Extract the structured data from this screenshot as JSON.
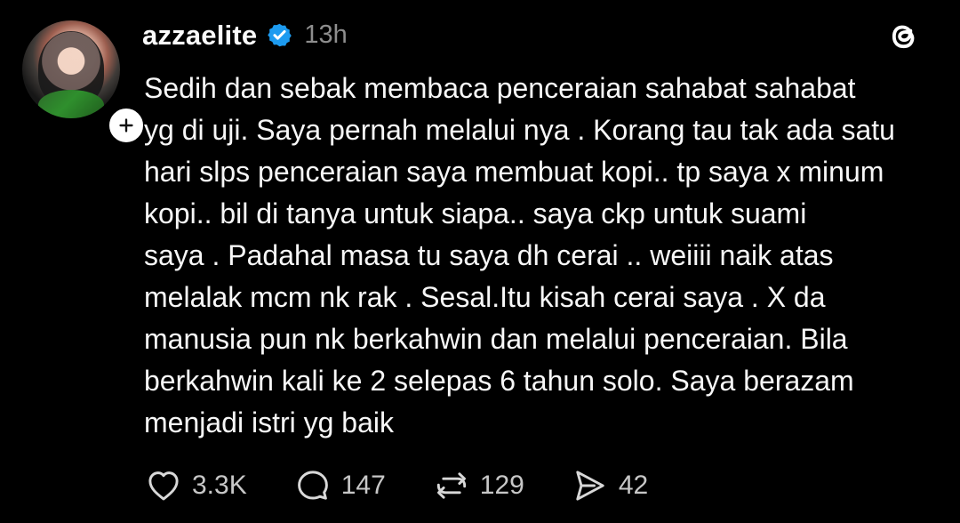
{
  "post": {
    "author": {
      "username": "azzaelite",
      "verified": true,
      "avatar_icon": "profile-avatar",
      "follow_icon": "plus-icon"
    },
    "time": "13h",
    "app_icon": "threads-logo",
    "text_lines": [
      "Sedih dan sebak membaca penceraian sahabat sahabat",
      "yg di uji. Saya pernah melalui nya . Korang tau tak ada satu",
      "hari slps penceraian saya membuat kopi.. tp saya x minum",
      "kopi.. bil di tanya untuk siapa.. saya ckp untuk suami",
      "saya . Padahal masa tu saya dh cerai .. weiiii naik atas",
      "melalak mcm nk rak . Sesal.Itu kisah cerai saya . X da",
      "manusia pun nk berkahwin dan melalui penceraian. Bila",
      "berkahwin kali ke 2 selepas 6 tahun solo. Saya berazam",
      "menjadi istri yg baik"
    ],
    "stats": {
      "likes": "3.3K",
      "replies": "147",
      "reposts": "129",
      "shares": "42"
    },
    "icons": {
      "like": "heart-icon",
      "reply": "comment-icon",
      "repost": "repost-icon",
      "share": "send-icon"
    },
    "colors": {
      "background": "#000000",
      "text": "#f7f7f7",
      "muted": "#8e8e8e",
      "verified": "#1d9bf0"
    }
  }
}
